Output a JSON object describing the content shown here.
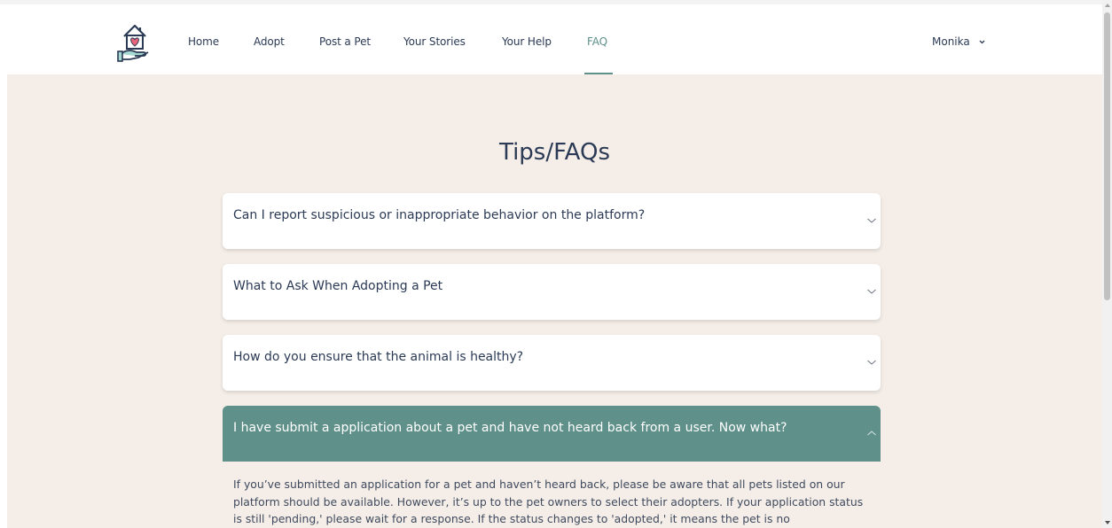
{
  "nav": {
    "links": [
      "Home",
      "Adopt",
      "Post a Pet",
      "Your Stories",
      "Your Help",
      "FAQ"
    ],
    "active": "FAQ",
    "user": "Monika"
  },
  "page": {
    "title": "Tips/FAQs"
  },
  "faqs": [
    {
      "question": "Can I report suspicious or inappropriate behavior on the platform?",
      "expanded": false
    },
    {
      "question": "What to Ask When Adopting a Pet",
      "expanded": false
    },
    {
      "question": "How do you ensure that the animal is healthy?",
      "expanded": false
    },
    {
      "question": "I have submit a application about a pet and have not heard back from a user. Now what?",
      "expanded": true,
      "answer": "If you’ve submitted an application for a pet and haven’t heard back, please be aware that all pets listed on our platform should be available. However, it’s up to the pet owners to select their adopters. If your application status is still 'pending,' please wait for a response. If the status changes to 'adopted,' it means the pet is no"
    }
  ],
  "colors": {
    "accent": "#5f9089",
    "page_background": "#f5eee8",
    "heading_text": "#2b3a55",
    "logo_heart": "#e8647a"
  }
}
